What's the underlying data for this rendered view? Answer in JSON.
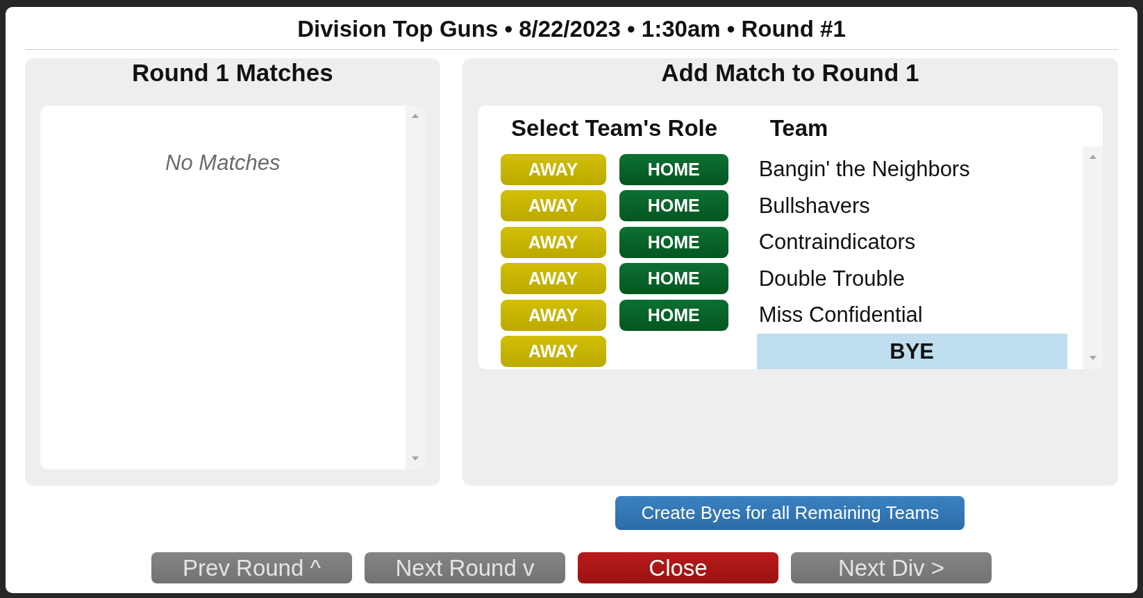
{
  "dialog": {
    "title": "Division Top Guns • 8/22/2023 • 1:30am • Round #1"
  },
  "matches_panel": {
    "title": "Round 1 Matches",
    "empty_text": "No Matches"
  },
  "add_match_panel": {
    "title": "Add Match to Round 1",
    "columns": [
      "Select Team's Role",
      "Team"
    ],
    "teams": [
      {
        "name": "Bangin' the Neighbors",
        "kind": "team",
        "roles": [
          {
            "label": "AWAY",
            "kind": "away"
          },
          {
            "label": "HOME",
            "kind": "home"
          }
        ]
      },
      {
        "name": "Bullshavers",
        "kind": "team",
        "roles": [
          {
            "label": "AWAY",
            "kind": "away"
          },
          {
            "label": "HOME",
            "kind": "home"
          }
        ]
      },
      {
        "name": "Contraindicators",
        "kind": "team",
        "roles": [
          {
            "label": "AWAY",
            "kind": "away"
          },
          {
            "label": "HOME",
            "kind": "home"
          }
        ]
      },
      {
        "name": "Double Trouble",
        "kind": "team",
        "roles": [
          {
            "label": "AWAY",
            "kind": "away"
          },
          {
            "label": "HOME",
            "kind": "home"
          }
        ]
      },
      {
        "name": "Miss Confidential",
        "kind": "team",
        "roles": [
          {
            "label": "AWAY",
            "kind": "away"
          },
          {
            "label": "HOME",
            "kind": "home"
          }
        ]
      },
      {
        "name": "BYE",
        "kind": "bye",
        "roles": [
          {
            "label": "AWAY",
            "kind": "away"
          }
        ]
      }
    ]
  },
  "create_byes_button": "Create Byes for all Remaining Teams",
  "buttons": [
    {
      "label": "Prev Round ^",
      "kind": "secondary"
    },
    {
      "label": "Next Round v",
      "kind": "secondary"
    },
    {
      "label": "Close",
      "kind": "danger"
    },
    {
      "label": "Next Div >",
      "kind": "secondary"
    }
  ]
}
